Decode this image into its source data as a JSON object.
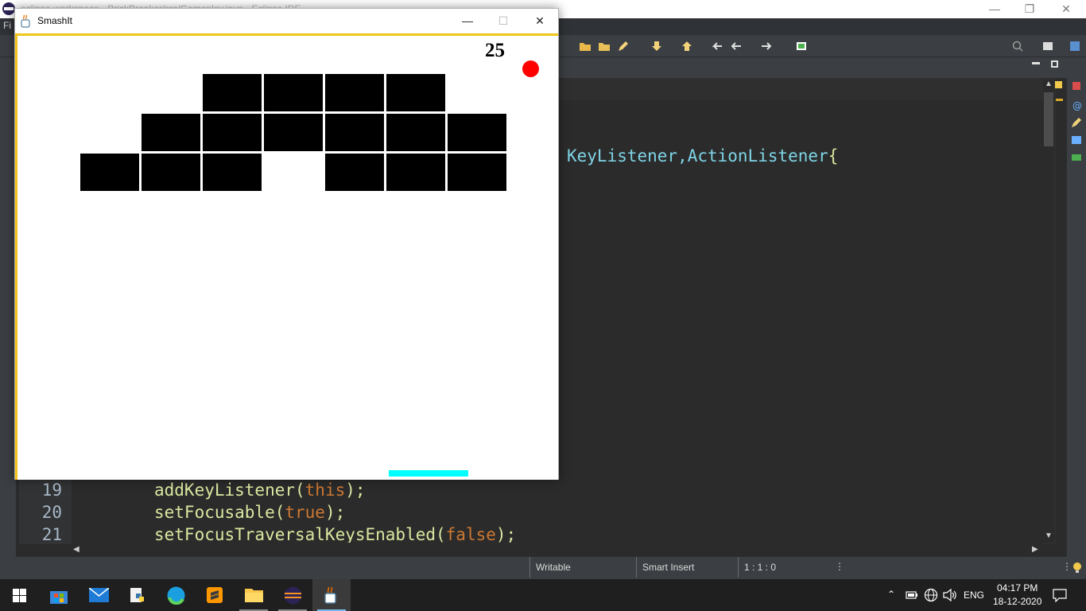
{
  "ide": {
    "title": "eclipse-workspace - BrickBreaker/src/Gameplay.java - Eclipse IDE",
    "menu_first_letter": "Fi",
    "code_header": "KeyListener,ActionListener",
    "code_header_brace": "{",
    "code": [
      {
        "line": "19",
        "pre": "addKeyListener(",
        "kw": "this",
        "post": ");"
      },
      {
        "line": "20",
        "pre": "setFocusable(",
        "kw": "true",
        "post": ");"
      },
      {
        "line": "21",
        "pre": "setFocusTraversalKeysEnabled(",
        "kw": "false",
        "post": ");"
      }
    ],
    "status": {
      "mode": "Writable",
      "insert": "Smart Insert",
      "position": "1 : 1 : 0"
    }
  },
  "game_window": {
    "title": "SmashIt",
    "score": "25",
    "ball_color": "#ff0000",
    "paddle_color": "#00ffff",
    "border_color": "#f0c419",
    "brick_color": "#000000",
    "bricks": [
      [
        0,
        0,
        1,
        1,
        1,
        1,
        0
      ],
      [
        0,
        1,
        1,
        1,
        1,
        1,
        1
      ],
      [
        1,
        1,
        1,
        0,
        1,
        1,
        1
      ]
    ]
  },
  "taskbar": {
    "apps": [
      "windows-start",
      "store",
      "mail",
      "python",
      "edge",
      "sublime",
      "file-explorer",
      "eclipse",
      "java"
    ],
    "language": "ENG",
    "time": "04:17 PM",
    "date": "18-12-2020"
  }
}
